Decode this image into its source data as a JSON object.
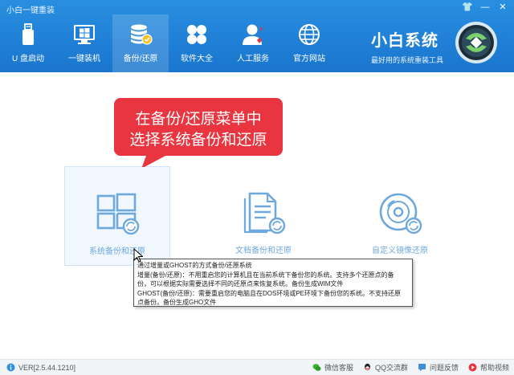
{
  "app": {
    "title": "小白一键重装"
  },
  "window_controls": {
    "skin": "👕",
    "minimize": "—",
    "close": "✕"
  },
  "nav": [
    {
      "label": "U 盘启动",
      "icon": "usb-drive-icon"
    },
    {
      "label": "一键装机",
      "icon": "windows-install-icon"
    },
    {
      "label": "备份/还原",
      "icon": "backup-restore-icon",
      "active": true
    },
    {
      "label": "软件大全",
      "icon": "software-apps-icon"
    },
    {
      "label": "人工服务",
      "icon": "customer-service-icon"
    },
    {
      "label": "官方网站",
      "icon": "globe-icon"
    }
  ],
  "brand": {
    "name": "小白系统",
    "slogan": "最好用的系统重装工具"
  },
  "callout": {
    "line1": "在备份/还原菜单中",
    "line2": "选择系统备份和还原"
  },
  "options": [
    {
      "label": "系统备份和还原",
      "icon": "windows-restore-icon",
      "selected": true
    },
    {
      "label": "文档备份和还原",
      "icon": "document-restore-icon"
    },
    {
      "label": "自定义镜像还原",
      "icon": "disc-image-icon"
    }
  ],
  "tooltip": {
    "line1": "通过增量或GHOST的方式备份/还原系统",
    "line2": "增量(备份/还原)：不用重启您的计算机且在当前系统下备份您的系统。支持多个还原点的备",
    "line3": "份，可以根据实际需要选择不同的还原点来恢复系统。备份生成WIM文件",
    "line4": "GHOST(备份/还原)：需要重启您的电脑且在DOS环境或PE环境下备份您的系统。不支持还原",
    "line5": "点备份。备份生成GHO文件"
  },
  "footer": {
    "version": "VER[2.5.44.1210]",
    "links": [
      {
        "label": "微信客服",
        "icon": "wechat-icon"
      },
      {
        "label": "QQ交流群",
        "icon": "qq-icon"
      },
      {
        "label": "问题反馈",
        "icon": "feedback-icon"
      },
      {
        "label": "帮助视频",
        "icon": "help-video-icon"
      }
    ]
  },
  "colors": {
    "header": "#1f7fd6",
    "callout": "#e8353f",
    "icon_blue": "#6fa8dc",
    "accent": "#2a8fe0"
  }
}
